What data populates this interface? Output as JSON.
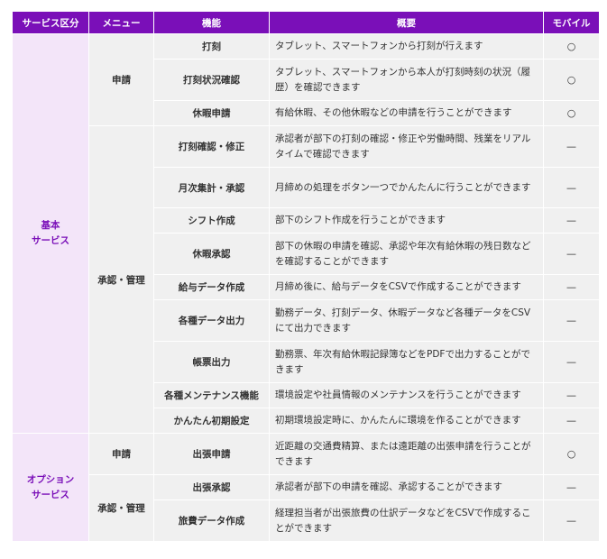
{
  "headers": {
    "category": "サービス区分",
    "menu": "メニュー",
    "function": "機能",
    "summary": "概要",
    "mobile": "モバイル"
  },
  "categories": {
    "basic": [
      "基本",
      "サービス"
    ],
    "option": [
      "オプション",
      "サービス"
    ]
  },
  "menus": {
    "apply": "申請",
    "approve": "承認・管理"
  },
  "rows": [
    {
      "function": "打刻",
      "summary": "タブレット、スマートフォンから打刻が行えます",
      "mobile": "○"
    },
    {
      "function": "打刻状況確認",
      "summary": "タブレット、スマートフォンから本人が打刻時刻の状況（履歴）を確認できます",
      "mobile": "○"
    },
    {
      "function": "休暇申請",
      "summary": "有給休暇、その他休暇などの申請を行うことができます",
      "mobile": "○"
    },
    {
      "function": "打刻確認・修正",
      "summary": "承認者が部下の打刻の確認・修正や労働時間、残業をリアルタイムで確認できます",
      "mobile": "—"
    },
    {
      "function": "月次集計・承認",
      "summary": "月締めの処理をボタン一つでかんたんに行うことができます",
      "mobile": "—"
    },
    {
      "function": "シフト作成",
      "summary": "部下のシフト作成を行うことができます",
      "mobile": "—"
    },
    {
      "function": "休暇承認",
      "summary": "部下の休暇の申請を確認、承認や年次有給休暇の残日数などを確認することができます",
      "mobile": "—"
    },
    {
      "function": "給与データ作成",
      "summary": "月締め後に、給与データをCSVで作成することができます",
      "mobile": "—"
    },
    {
      "function": "各種データ出力",
      "summary": "勤務データ、打刻データ、休暇データなど各種データをCSVにて出力できます",
      "mobile": "—"
    },
    {
      "function": "帳票出力",
      "summary": "勤務票、年次有給休暇記録簿などをPDFで出力することができます",
      "mobile": "—"
    },
    {
      "function": "各種メンテナンス機能",
      "summary": "環境設定や社員情報のメンテナンスを行うことができます",
      "mobile": "—"
    },
    {
      "function": "かんたん初期設定",
      "summary": "初期環境設定時に、かんたんに環境を作ることができます",
      "mobile": "—"
    },
    {
      "function": "出張申請",
      "summary": "近距離の交通費精算、または遠距離の出張申請を行うことができます",
      "mobile": "○"
    },
    {
      "function": "出張承認",
      "summary": "承認者が部下の申請を確認、承認することができます",
      "mobile": "—"
    },
    {
      "function": "旅費データ作成",
      "summary": "経理担当者が出張旅費の仕訳データなどをCSVで作成することができます",
      "mobile": "—"
    }
  ]
}
